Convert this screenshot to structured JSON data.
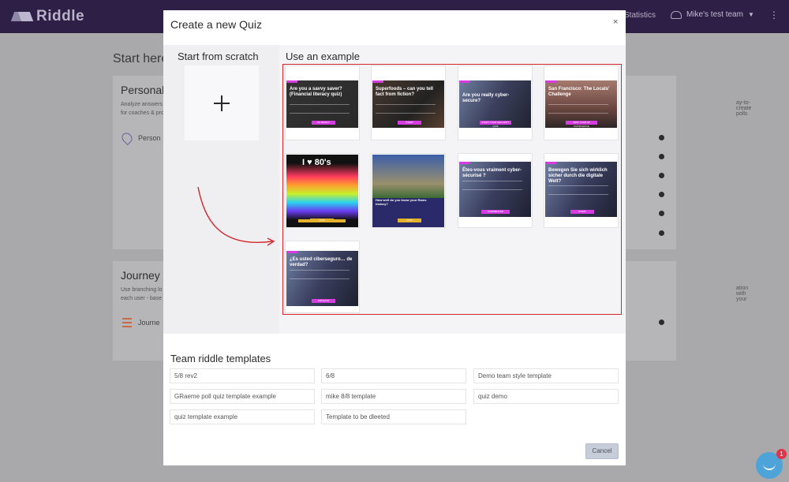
{
  "app": {
    "brand": "Riddle",
    "nav_statistics": "Statistics",
    "team_name": "Mike's test team",
    "more_menu": "⋮"
  },
  "background": {
    "title": "Start here",
    "card1": {
      "heading": "Personal",
      "desc_line1": "Analyze answers",
      "desc_line2": "for coaches & pro",
      "right_text": "ay-to-create polls",
      "item": "Person"
    },
    "card2": {
      "heading": "Journey",
      "desc_line1": "Use branching lo",
      "desc_line2": "each user - base",
      "right_text": "ation with your",
      "item": "Journe"
    }
  },
  "modal": {
    "title": "Create a new Quiz",
    "close": "×",
    "scratch_heading": "Start from scratch",
    "example_heading": "Use an example",
    "examples": [
      {
        "title": "Are you a savvy saver? (Financial literacy quiz)",
        "theme": "dark",
        "button": "I'M READY!"
      },
      {
        "title": "Superfoods – can you tell fact from fiction?",
        "theme": "food",
        "button": "START"
      },
      {
        "title": "Are you really cyber-secure?",
        "theme": "laptop",
        "button": "START YOUR SECURITY QUIZ"
      },
      {
        "title": "San Francisco: The Locals' Challenge",
        "theme": "sf",
        "button": "TEST YOUR SF KNOWLEDGE"
      },
      {
        "title": "I ♥ 80's",
        "theme": "80s",
        "button": "QUIZ"
      },
      {
        "title": "How well do you know your Rams history?",
        "theme": "football",
        "button": "QUIZ"
      },
      {
        "title": "Êtes-vous vraiment cyber-sécurisé ?",
        "theme": "laptop2",
        "button": "COMMENCER"
      },
      {
        "title": "Bewegen Sie sich wirklich sicher durch die digitale Welt?",
        "theme": "laptop2",
        "button": "START"
      },
      {
        "title": "¿Es usted ciberseguro… de verdad?",
        "theme": "laptop2",
        "button": "EMPEZAR"
      }
    ],
    "team_heading": "Team riddle templates",
    "team_templates": [
      "5/8 rev2",
      "6/8",
      "Demo team style template",
      "GRaeme poll quiz template example",
      "mike 8/8 template",
      "quiz demo",
      "quiz template example",
      "Template to be dleeted"
    ],
    "cancel_label": "Cancel"
  },
  "chat": {
    "badge": "1"
  },
  "colors": {
    "topbar": "#2e1f46",
    "highlight_border": "#d5262c",
    "arrow": "#d5262c",
    "accent_magenta": "#d63de0",
    "chat": "#4ea4d9"
  }
}
